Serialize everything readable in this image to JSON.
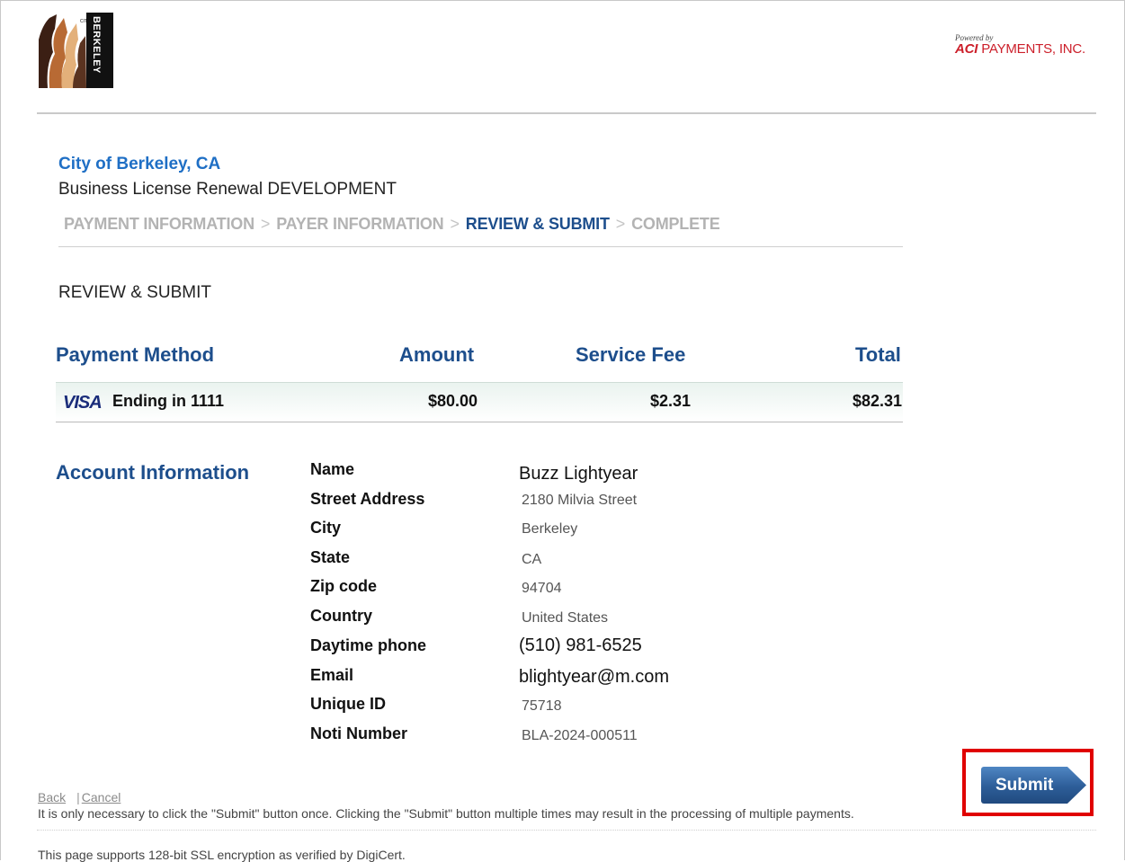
{
  "header": {
    "logo_text": "CITY OF BERKELEY",
    "powered_by": "Powered by",
    "provider_bold": "ACI",
    "provider_rest": " PAYMENTS, INC."
  },
  "page": {
    "city": "City of Berkeley, CA",
    "service": "Business License Renewal DEVELOPMENT",
    "section_title": "REVIEW & SUBMIT"
  },
  "steps": [
    {
      "label": "PAYMENT INFORMATION",
      "active": false
    },
    {
      "label": "PAYER INFORMATION",
      "active": false
    },
    {
      "label": "REVIEW & SUBMIT",
      "active": true
    },
    {
      "label": "COMPLETE",
      "active": false
    }
  ],
  "step_separator": ">",
  "payment_table": {
    "headers": {
      "method": "Payment Method",
      "amount": "Amount",
      "fee": "Service Fee",
      "total": "Total"
    },
    "row": {
      "card_brand": "VISA",
      "card_desc": "Ending in 1111",
      "amount": "$80.00",
      "fee": "$2.31",
      "total": "$82.31"
    }
  },
  "account": {
    "title": "Account Information",
    "fields": [
      {
        "label": "Name",
        "value": "Buzz Lightyear"
      },
      {
        "label": "Street Address",
        "value": "2180 Milvia Street"
      },
      {
        "label": "City",
        "value": "Berkeley"
      },
      {
        "label": "State",
        "value": "CA"
      },
      {
        "label": "Zip code",
        "value": "94704"
      },
      {
        "label": "Country",
        "value": "United States"
      },
      {
        "label": "Daytime phone",
        "value": "(510) 981-6525"
      },
      {
        "label": "Email",
        "value": "blightyear@m.com"
      },
      {
        "label": "Unique ID",
        "value": "75718"
      },
      {
        "label": "Noti Number",
        "value": "BLA-2024-000511"
      }
    ]
  },
  "actions": {
    "back": "Back",
    "cancel": "Cancel",
    "submit": "Submit"
  },
  "footer": {
    "note": "It is only necessary to click the \"Submit\" button once. Clicking the \"Submit\" button multiple times may result in the processing of multiple payments.",
    "ssl": "This page supports 128-bit SSL encryption as verified by DigiCert."
  },
  "colors": {
    "link_blue": "#1f6fc5",
    "heading_navy": "#1d4e8c",
    "highlight_red": "#e00000"
  }
}
